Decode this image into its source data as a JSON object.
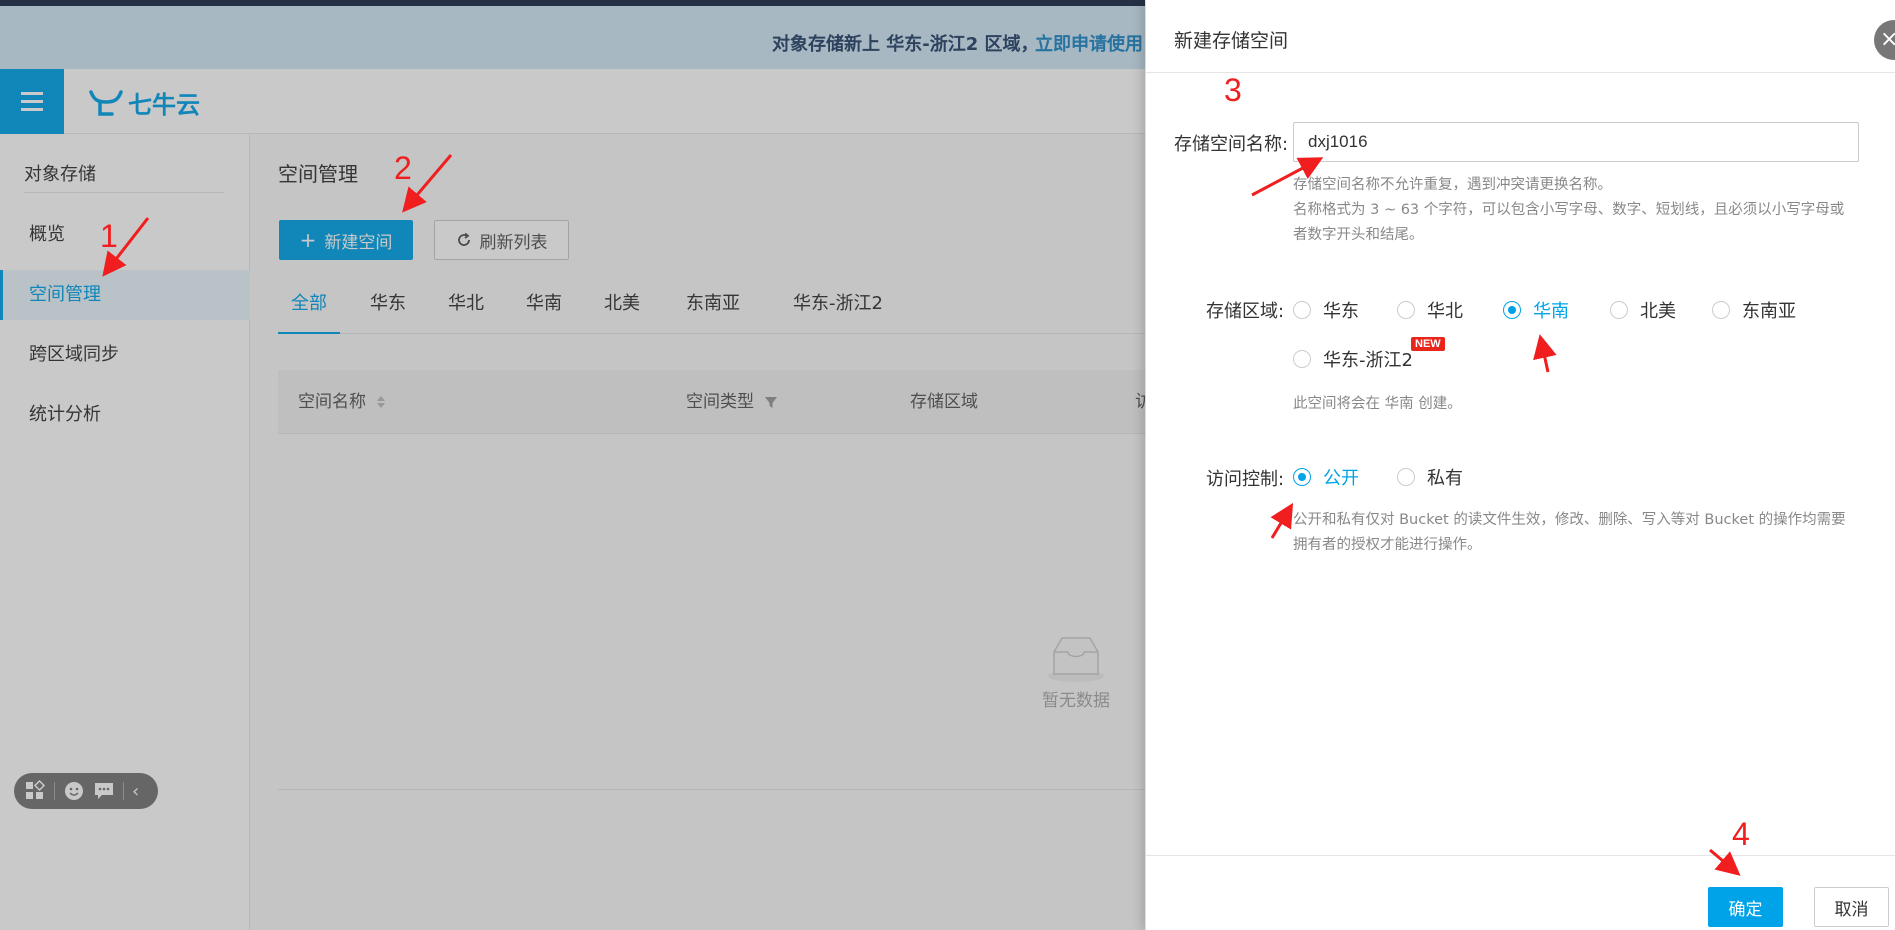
{
  "banner": {
    "text": "对象存储新上 华东-浙江2 区域，",
    "link": "立即申请使用"
  },
  "header": {
    "logo_text": "七牛云",
    "menu_icon": "menu-icon"
  },
  "sidebar": {
    "title": "对象存储",
    "items": [
      {
        "label": "概览",
        "active": false
      },
      {
        "label": "空间管理",
        "active": true
      },
      {
        "label": "跨区域同步",
        "active": false
      },
      {
        "label": "统计分析",
        "active": false
      }
    ]
  },
  "main": {
    "title": "空间管理",
    "new_button": "新建空间",
    "refresh_button": "刷新列表",
    "tabs": [
      "全部",
      "华东",
      "华北",
      "华南",
      "北美",
      "东南亚",
      "华东-浙江2"
    ],
    "active_tab": 0,
    "columns": [
      "空间名称",
      "空间类型",
      "存储区域",
      "访"
    ],
    "empty_text": "暂无数据"
  },
  "drawer": {
    "title": "新建存储空间",
    "close_icon": "close-icon",
    "name_label": "存储空间名称:",
    "name_value": "dxj1016",
    "name_hint_1": "存储空间名称不允许重复，遇到冲突请更换名称。",
    "name_hint_2": "名称格式为 3 ~ 63 个字符，可以包含小写字母、数字、短划线，且必须以小写字母或",
    "name_hint_3": "者数字开头和结尾。",
    "region_label": "存储区域:",
    "regions": [
      "华东",
      "华北",
      "华南",
      "北美",
      "东南亚",
      "华东-浙江2"
    ],
    "selected_region": "华南",
    "new_badge": "NEW",
    "region_hint": "此空间将会在 华南 创建。",
    "access_label": "访问控制:",
    "access_options": [
      "公开",
      "私有"
    ],
    "selected_access": "公开",
    "access_hint_1": "公开和私有仅对 Bucket 的读文件生效，修改、删除、写入等对 Bucket 的操作均需要",
    "access_hint_2": "拥有者的授权才能进行操作。",
    "ok_button": "确定",
    "cancel_button": "取消"
  },
  "annotations": [
    "1",
    "2",
    "3",
    "4"
  ],
  "colors": {
    "accent": "#00a3e8",
    "annotation": "#f01e1e",
    "banner_bg": "#d2e8f6"
  }
}
